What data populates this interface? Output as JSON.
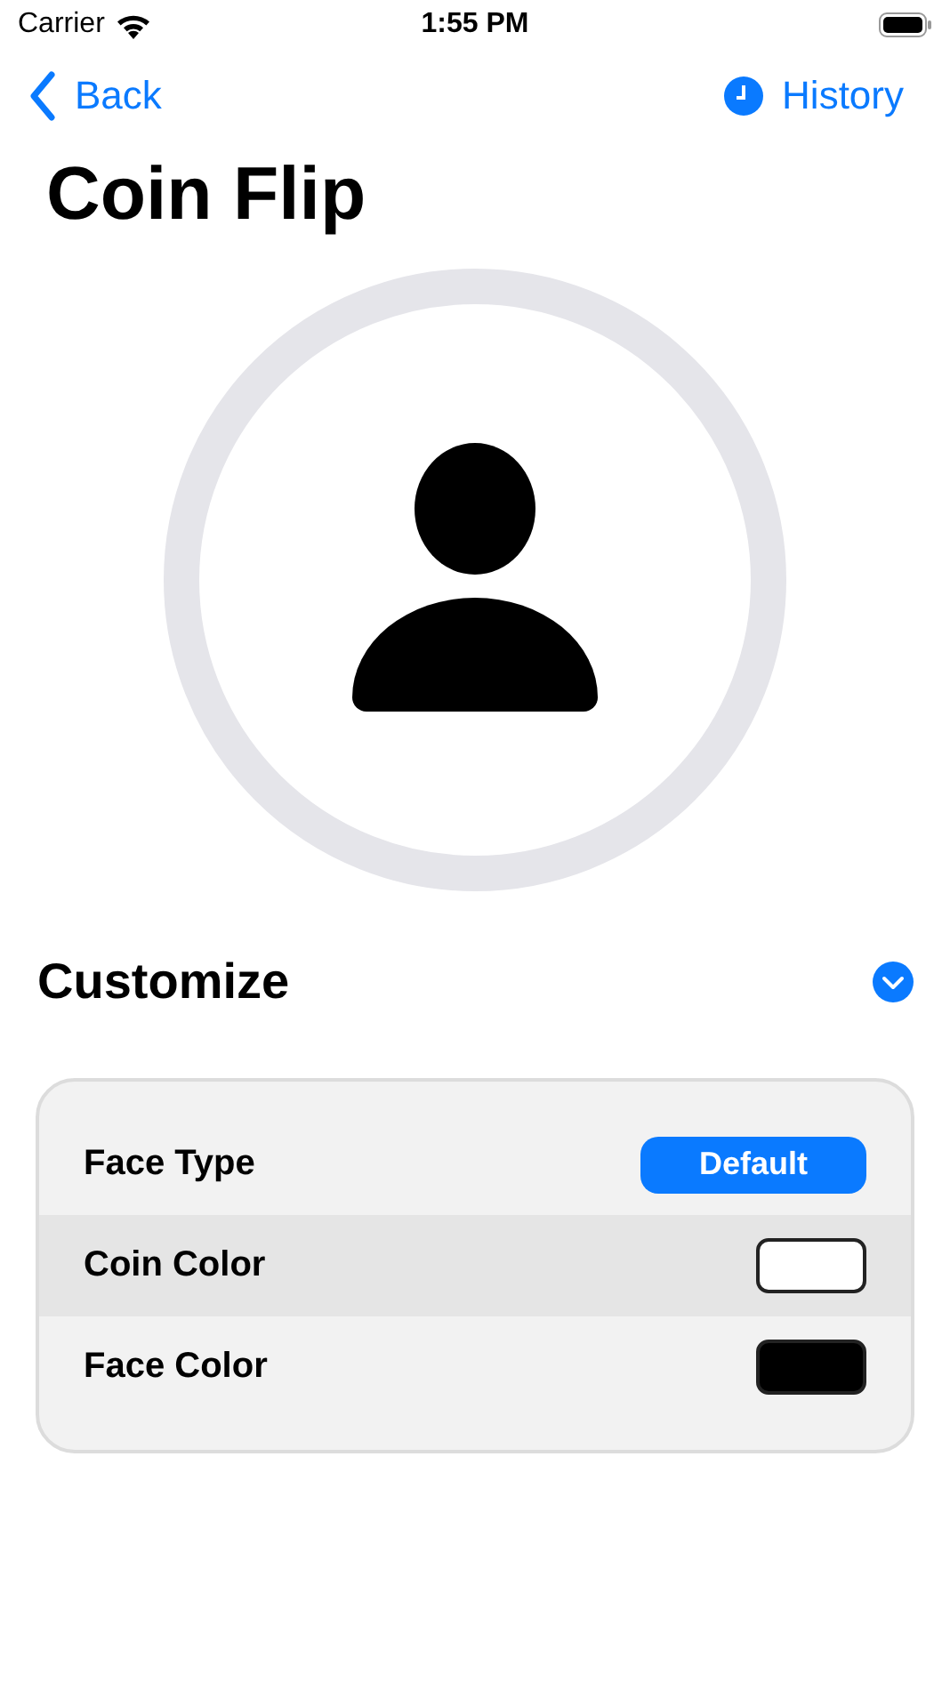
{
  "status_bar": {
    "carrier": "Carrier",
    "time": "1:55 PM"
  },
  "nav": {
    "back": "Back",
    "history": "History"
  },
  "title": "Coin Flip",
  "customize": {
    "title": "Customize",
    "expanded": true
  },
  "options": [
    {
      "label": "Face Type",
      "kind": "button",
      "value": "Default",
      "selected": false
    },
    {
      "label": "Coin Color",
      "kind": "swatch",
      "color": "#ffffff",
      "selected": true
    },
    {
      "label": "Face Color",
      "kind": "swatch",
      "color": "#000000",
      "selected": false
    }
  ]
}
